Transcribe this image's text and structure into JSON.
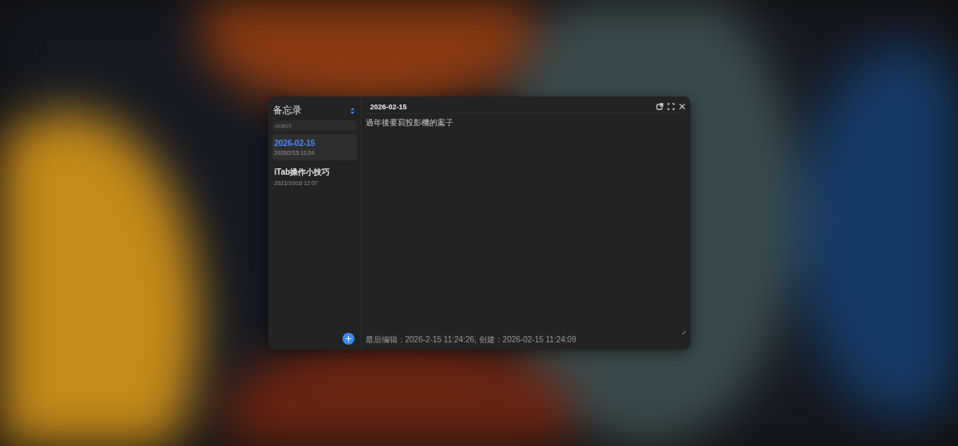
{
  "sidebar": {
    "title": "备忘录",
    "search": {
      "placeholder": "search"
    },
    "notes": [
      {
        "title": "2026-02-15",
        "time": "2026/2/15 11:24",
        "selected": true
      },
      {
        "title": "iTab操作小技巧",
        "time": "2021/10/16 12:07",
        "selected": false
      }
    ]
  },
  "editor": {
    "title": "2026-02-15",
    "content": "過年後要寫投影機的案子",
    "footer": "最后编辑：2026-2-15 11:24:26, 创建：2026-02-15 11:24:09"
  }
}
